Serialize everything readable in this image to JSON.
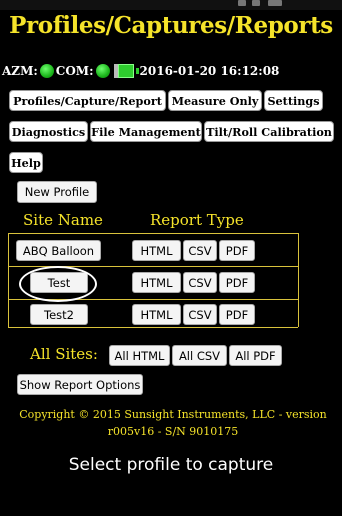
{
  "header": {
    "title": "Profiles/Captures/Reports"
  },
  "status": {
    "azm_label": "AZM:",
    "com_label": "COM:",
    "datetime": "2016-01-20 16:12:08",
    "azm_color": "#22cc22",
    "com_color": "#22cc22",
    "battery_color": "#2ecc2e"
  },
  "tabs": [
    {
      "label": "Profiles/Capture/Report"
    },
    {
      "label": "Measure Only"
    },
    {
      "label": "Settings"
    },
    {
      "label": "Diagnostics"
    },
    {
      "label": "File Management"
    },
    {
      "label": "Tilt/Roll Calibration"
    },
    {
      "label": "Help"
    }
  ],
  "actions": {
    "new_profile": "New Profile"
  },
  "table": {
    "headers": {
      "site_name": "Site Name",
      "report_type": "Report Type"
    },
    "rows": [
      {
        "site": "ABQ Balloon",
        "html": "HTML",
        "csv": "CSV",
        "pdf": "PDF"
      },
      {
        "site": "Test",
        "html": "HTML",
        "csv": "CSV",
        "pdf": "PDF"
      },
      {
        "site": "Test2",
        "html": "HTML",
        "csv": "CSV",
        "pdf": "PDF"
      }
    ]
  },
  "all_sites": {
    "label": "All Sites:",
    "all_html": "All HTML",
    "all_csv": "All CSV",
    "all_pdf": "All PDF"
  },
  "report_options": {
    "label": "Show Report Options"
  },
  "footer": {
    "copyright_line1": "Copyright © 2015 Sunsight Instruments, LLC - version",
    "copyright_line2": "r005v16 - S/N 9010175",
    "prompt": "Select profile to capture"
  },
  "colors": {
    "accent": "#f5e32a",
    "background": "#000000",
    "indicator_green": "#22cc22"
  }
}
